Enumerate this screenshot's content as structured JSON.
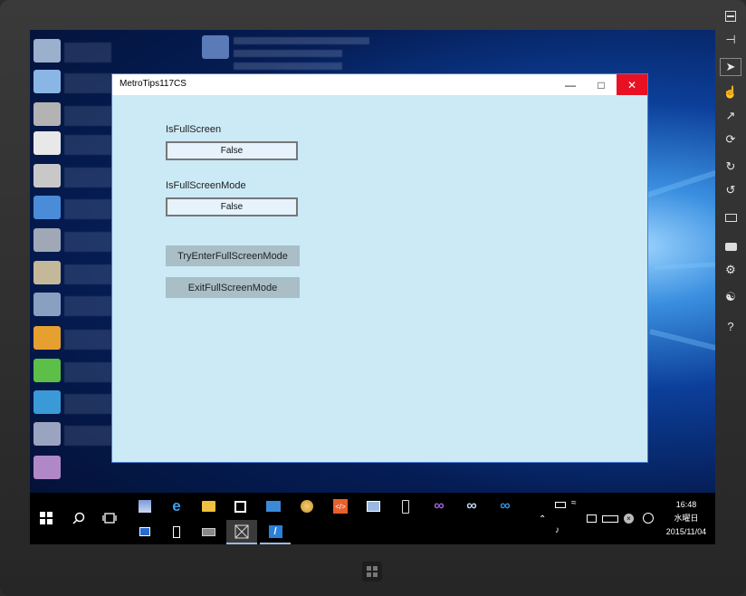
{
  "window": {
    "title": "MetroTips117CS",
    "minimize": "—",
    "maximize": "□",
    "close": "✕"
  },
  "app": {
    "isfullscreen_label": "IsFullScreen",
    "isfullscreen_value": "False",
    "isfullscreenmode_label": "IsFullScreenMode",
    "isfullscreenmode_value": "False",
    "try_enter_button": "TryEnterFullScreenMode",
    "exit_button": "ExitFullScreenMode"
  },
  "taskbar": {
    "apps": [
      "store",
      "edge",
      "explorer",
      "store-bag",
      "people",
      "paint",
      "code",
      "settings",
      "phone",
      "visual-studio",
      "vs-code",
      "vs-blue"
    ],
    "second_row": [
      "taskview-app",
      "phone-app",
      "media-app",
      "metro-app",
      "azure-app"
    ],
    "clock": {
      "time": "16:48",
      "day": "水曜日",
      "date": "2015/11/04"
    }
  },
  "sidebar": {
    "items": [
      "minimize",
      "pin",
      "pointer",
      "touch",
      "pinch",
      "rotate-touch",
      "rotate-cw",
      "rotate-ccw",
      "monitor",
      "camera",
      "settings",
      "network",
      "help"
    ],
    "help_label": "?"
  },
  "colors": {
    "window_bg": "#cceaf6",
    "button_bg": "#a9bec6",
    "close_red": "#e81123"
  }
}
